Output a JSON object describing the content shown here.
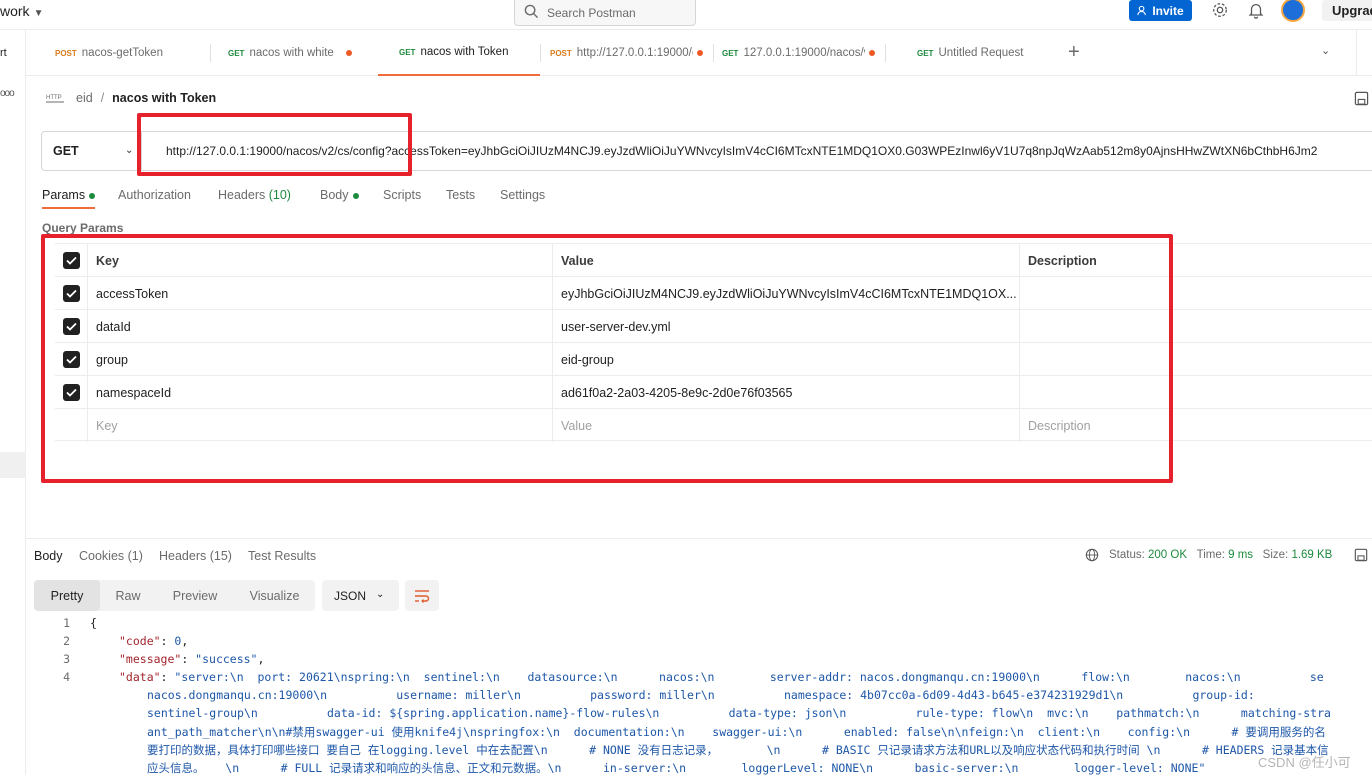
{
  "topbar": {
    "workspace": "work",
    "search_placeholder": "Search Postman",
    "invite_label": "Invite",
    "upgrade_label": "Upgrad"
  },
  "sidebar": {
    "item_label": "rt",
    "dots": "ooo"
  },
  "tabs": [
    {
      "method": "POST",
      "label": "nacos-getToken"
    },
    {
      "method": "GET",
      "label": "nacos with white"
    },
    {
      "method": "GET",
      "label": "nacos with Token"
    },
    {
      "method": "POST",
      "label": "http://127.0.0.1:19000/("
    },
    {
      "method": "GET",
      "label": "127.0.0.1:19000/nacos/v"
    },
    {
      "method": "GET",
      "label": "Untitled Request"
    }
  ],
  "breadcrumb": {
    "icon_label": "HTTP",
    "parent": "eid",
    "separator": "/",
    "title": "nacos with Token"
  },
  "request": {
    "method": "GET",
    "url": "http://127.0.0.1:19000/nacos/v2/cs/config?accessToken=eyJhbGciOiJIUzM4NCJ9.eyJzdWliOiJuYWNvcyIsImV4cCI6MTcxNTE1MDQ1OX0.G03WPEzInwl6yV1U7q8npJqWzAab512m8y0AjnsHHwZWtXN6bCthbH6Jm2"
  },
  "request_tabs": {
    "params": "Params",
    "authorization": "Authorization",
    "headers": "Headers",
    "headers_count": "(10)",
    "body": "Body",
    "scripts": "Scripts",
    "tests": "Tests",
    "settings": "Settings"
  },
  "query_params": {
    "title": "Query Params",
    "headers": {
      "key": "Key",
      "value": "Value",
      "description": "Description"
    },
    "rows": [
      {
        "key": "accessToken",
        "value": "eyJhbGciOiJIUzM4NCJ9.eyJzdWliOiJuYWNvcyIsImV4cCI6MTcxNTE1MDQ1OX..."
      },
      {
        "key": "dataId",
        "value": "user-server-dev.yml"
      },
      {
        "key": "group",
        "value": "eid-group"
      },
      {
        "key": "namespaceId",
        "value": "ad61f0a2-2a03-4205-8e9c-2d0e76f03565"
      }
    ],
    "placeholder": {
      "key": "Key",
      "value": "Value",
      "description": "Description"
    }
  },
  "response": {
    "tabs": {
      "body": "Body",
      "cookies": "Cookies (1)",
      "headers": "Headers (15)",
      "test_results": "Test Results"
    },
    "status_label": "Status:",
    "status_value": "200 OK",
    "time_label": "Time:",
    "time_value": "9 ms",
    "size_label": "Size:",
    "size_value": "1.69 KB",
    "view_modes": [
      "Pretty",
      "Raw",
      "Preview",
      "Visualize"
    ],
    "format": "JSON",
    "code": {
      "l1": "{",
      "l2_key": "\"code\"",
      "l2_val": "0",
      "l3_key": "\"message\"",
      "l3_val": "\"success\"",
      "l4_key": "\"data\"",
      "l4_val": "\"server:\\n  port: 20621\\nspring:\\n  sentinel:\\n    datasource:\\n      nacos:\\n        server-addr: nacos.dongmanqu.cn:19000\\n      flow:\\n        nacos:\\n          se",
      "w1": "nacos.dongmanqu.cn:19000\\n          username: miller\\n          password: miller\\n          namespace: 4b07cc0a-6d09-4d43-b645-e374231929d1\\n          group-id:",
      "w2": "sentinel-group\\n          data-id: ${spring.application.name}-flow-rules\\n          data-type: json\\n          rule-type: flow\\n  mvc:\\n    pathmatch:\\n      matching-stra",
      "w3": "ant_path_matcher\\n\\n#禁用swagger-ui 使用knife4j\\nspringfox:\\n  documentation:\\n    swagger-ui:\\n      enabled: false\\n\\nfeign:\\n  client:\\n    config:\\n      # 要调用服务的名",
      "w4": "要打印的数据，具体打印哪些接口 要自己 在logging.level 中在去配置\\n      # NONE 没有日志记录，       \\n      # BASIC 只记录请求方法和URL以及响应状态代码和执行时间 \\n      # HEADERS 记录基本信",
      "w5": "应头信息。   \\n      # FULL 记录请求和响应的头信息、正文和元数据。\\n      in-server:\\n        loggerLevel: NONE\\n      basic-server:\\n        logger-level: NONE\""
    }
  },
  "watermark": "CSDN @任小可",
  "colors": {
    "accent": "#f26b3a",
    "annotation_red": "#e5212b",
    "invite_blue": "#0265d2",
    "success_green": "#1d8a3d"
  }
}
